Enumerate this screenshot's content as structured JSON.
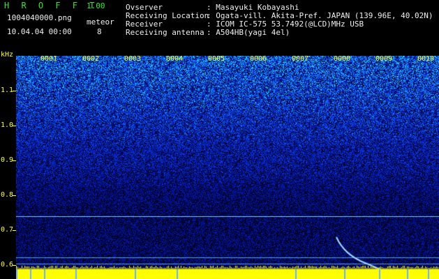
{
  "header": {
    "app_name": "H R O F F T",
    "version": "1.00",
    "filename": "1004040000.png",
    "datetime": "10.04.04 00:00",
    "meteor_label": "meteor",
    "meteor_count": "8",
    "info": [
      {
        "label": "Ovserver",
        "value": ": Masayuki Kobayashi"
      },
      {
        "label": "Receiving Location",
        "value": ": Ogata-vill. Akita-Pref. JAPAN (139.96E, 40.02N)"
      },
      {
        "label": "Receiver",
        "value": ": ICOM IC-575 53.7492(@LCD)MHz USB"
      },
      {
        "label": "Receiving antenna",
        "value": ": A504HB(yagi 4el)"
      }
    ]
  },
  "spectrogram": {
    "y_unit": "kHz",
    "y_ticks": [
      "1.1",
      "1.0",
      "0.9",
      "0.8",
      "0.7",
      "0.6"
    ],
    "segments": [
      "0001",
      "0002",
      "0003",
      "0004",
      "0005",
      "0006",
      "0007",
      "0008",
      "0009",
      "0010"
    ],
    "colors": {
      "axis": "#ffff33",
      "noise_strong": "#22aaff",
      "floor": "#ffff00"
    }
  }
}
